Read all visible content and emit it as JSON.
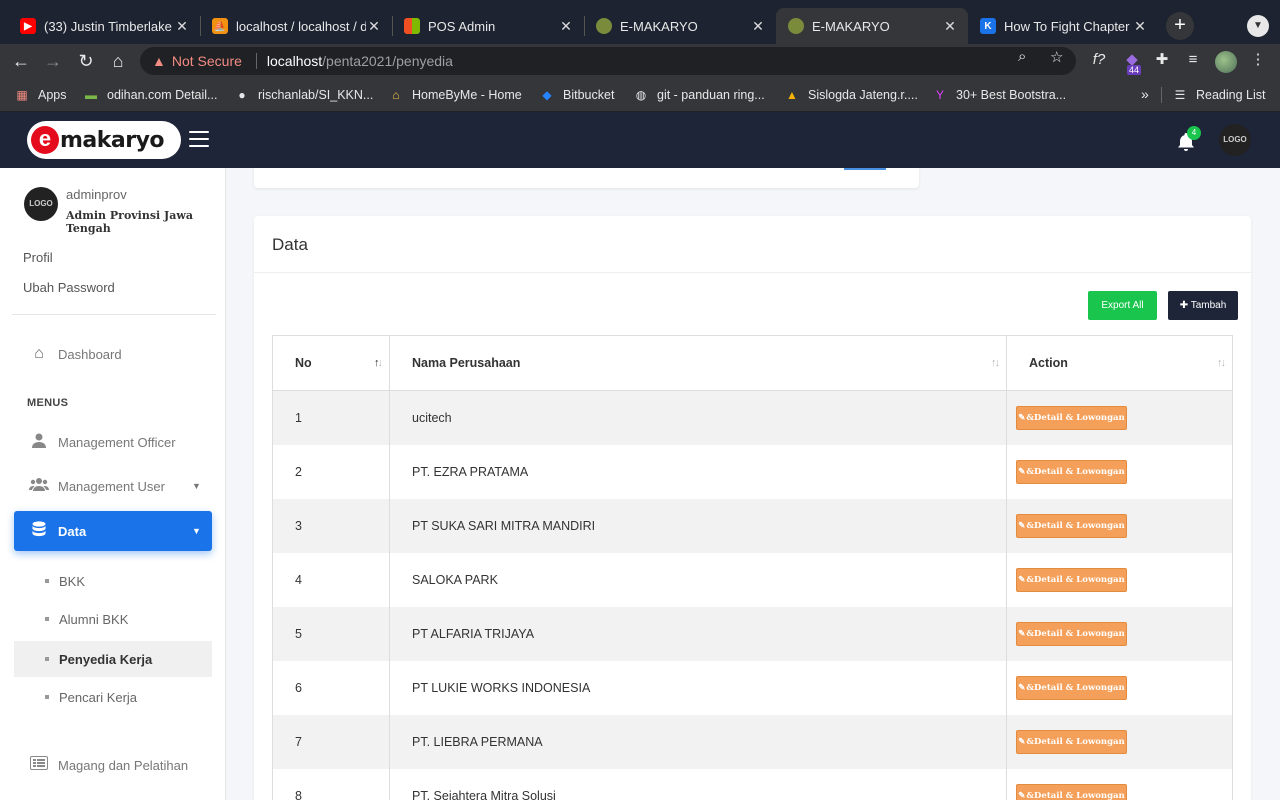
{
  "browser": {
    "tabs": [
      {
        "title": "(33) Justin Timberlake",
        "favicon_color": "#ff0000"
      },
      {
        "title": "localhost / localhost / d",
        "favicon_color": "#f29111"
      },
      {
        "title": "POS Admin",
        "favicon_color": "#4caf50"
      },
      {
        "title": "E-MAKARYO",
        "favicon_color": "#7a8c3c"
      },
      {
        "title": "E-MAKARYO",
        "favicon_color": "#7a8c3c"
      },
      {
        "title": "How To Fight Chapter",
        "favicon_color": "#1a73e8"
      }
    ],
    "address": {
      "security": "Not Secure",
      "host": "localhost",
      "path": "/penta2021/penyedia"
    },
    "extension_badge": "44",
    "bookmarks": [
      {
        "label": "Apps"
      },
      {
        "label": "odihan.com Detail..."
      },
      {
        "label": "rischanlab/SI_KKN..."
      },
      {
        "label": "HomeByMe - Home"
      },
      {
        "label": "Bitbucket"
      },
      {
        "label": "git - panduan ring..."
      },
      {
        "label": "Sislogda Jateng.r...."
      },
      {
        "label": "30+ Best Bootstra..."
      }
    ],
    "reading_list": "Reading List"
  },
  "header": {
    "logo_text": "makaryo",
    "logo_letter": "e",
    "notification_count": "4",
    "avatar_text": "LOGO"
  },
  "sidebar": {
    "avatar_text": "LOGO",
    "username": "adminprov",
    "role": "Admin Provinsi Jawa Tengah",
    "links": {
      "profile": "Profil",
      "change_password": "Ubah Password"
    },
    "dashboard": "Dashboard",
    "section_label": "MENUS",
    "management_officer": "Management Officer",
    "management_user": "Management User",
    "data": "Data",
    "data_sub": [
      "BKK",
      "Alumni BKK",
      "Penyedia Kerja",
      "Pencari Kerja"
    ],
    "magang": "Magang dan Pelatihan"
  },
  "main": {
    "card_title": "Data",
    "export_label": "Export All",
    "add_label": "Tambah",
    "columns": {
      "no": "No",
      "name": "Nama Perusahaan",
      "action": "Action"
    },
    "detail_label": "&Detail & Lowongan",
    "rows": [
      {
        "no": "1",
        "name": "ucitech"
      },
      {
        "no": "2",
        "name": "PT. EZRA PRATAMA"
      },
      {
        "no": "3",
        "name": "PT SUKA SARI MITRA MANDIRI"
      },
      {
        "no": "4",
        "name": "SALOKA PARK"
      },
      {
        "no": "5",
        "name": "PT ALFARIA TRIJAYA"
      },
      {
        "no": "6",
        "name": "PT LUKIE WORKS INDONESIA"
      },
      {
        "no": "7",
        "name": "PT. LIEBRA PERMANA"
      },
      {
        "no": "8",
        "name": "PT. Sejahtera Mitra Solusi"
      }
    ]
  }
}
